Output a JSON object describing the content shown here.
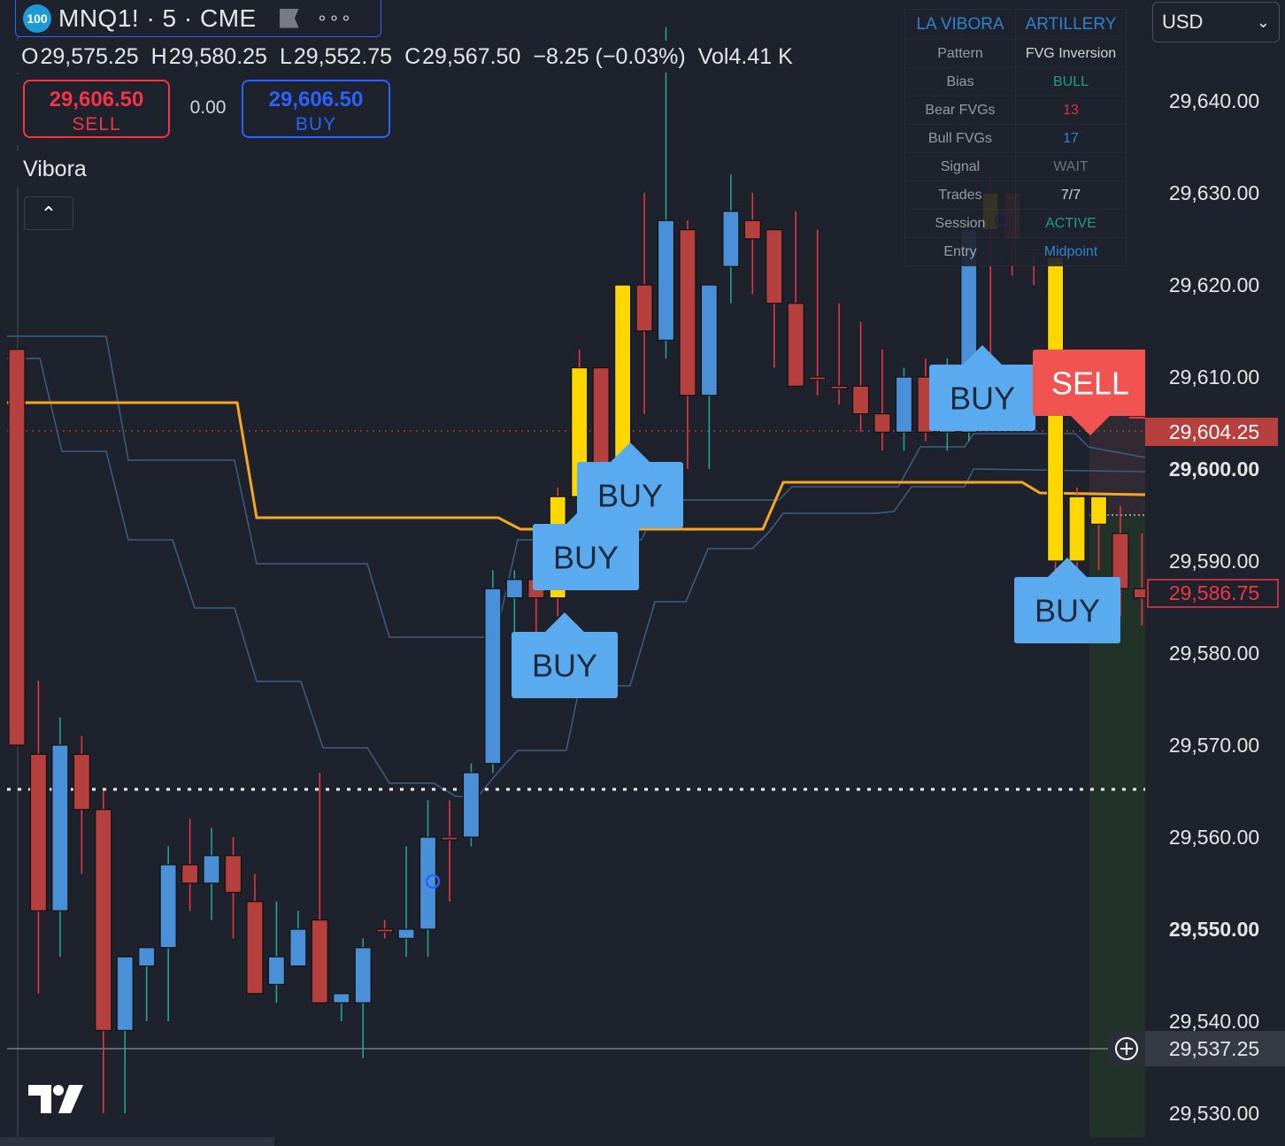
{
  "symbol": {
    "badge": "100",
    "text": "MNQ1! · 5 · CME"
  },
  "ohlc": {
    "open_label": "O",
    "open": "29,575.25",
    "high_label": "H",
    "high": "29,580.25",
    "low_label": "L",
    "low": "29,552.75",
    "close_label": "C",
    "close": "29,567.50",
    "change": "−8.25 (−0.03%)",
    "volume_label": "Vol",
    "volume": "4.41 K"
  },
  "order_panel": {
    "sell_price": "29,606.50",
    "sell_label": "SELL",
    "spread": "0.00",
    "buy_price": "29,606.50",
    "buy_label": "BUY"
  },
  "indicator": {
    "name": "Vibora",
    "collapse_icon": "chevron-up-icon"
  },
  "currency": {
    "value": "USD",
    "icon": "chevron-down-icon"
  },
  "info_table": {
    "header": [
      "LA VIBORA",
      "ARTILLERY"
    ],
    "rows": [
      {
        "label": "Pattern",
        "value": "FVG Inversion",
        "color": "#e6e6e6"
      },
      {
        "label": "Bias",
        "value": "BULL",
        "color": "#22ab94"
      },
      {
        "label": "Bear FVGs",
        "value": "13",
        "color": "#f23645"
      },
      {
        "label": "Bull FVGs",
        "value": "17",
        "color": "#2f8fe0"
      },
      {
        "label": "Signal",
        "value": "WAIT",
        "color": "#787b86"
      },
      {
        "label": "Trades",
        "value": "7/7",
        "color": "#e6e6e6"
      },
      {
        "label": "Session",
        "value": "ACTIVE",
        "color": "#22ab94"
      },
      {
        "label": "Entry",
        "value": "Midpoint",
        "color": "#2f8fe0"
      }
    ]
  },
  "price_axis": {
    "ticks": [
      "29,640.00",
      "29,630.00",
      "29,620.00",
      "29,610.00",
      "29,600.00",
      "29,590.00",
      "29,580.00",
      "29,570.00",
      "29,560.00",
      "29,550.00",
      "29,540.00",
      "29,530.00"
    ],
    "bold_ticks": [
      "29,600.00",
      "29,550.00"
    ],
    "labels": {
      "sell_price": "29,604.25",
      "last_price": "29,586.75",
      "crosshair_price": "29,537.25"
    }
  },
  "colors": {
    "bull": "#4a90d9",
    "bear": "#b6403d",
    "highlight": "#ffd700",
    "orange_line": "#f5a623",
    "band_line": "#3b5f85",
    "buy_label_bg": "#5aaaf0",
    "sell_label_bg": "#f05350"
  },
  "chart_data": {
    "type": "candlestick",
    "ylim": [
      29526,
      29650
    ],
    "candles": [
      {
        "o": 29613.0,
        "h": 29613.0,
        "l": 29570.0,
        "c": 29570.0,
        "t": "bear"
      },
      {
        "o": 29569.0,
        "h": 29577.0,
        "l": 29543.0,
        "c": 29552.0,
        "t": "bear"
      },
      {
        "o": 29552.0,
        "h": 29573.0,
        "l": 29547.0,
        "c": 29570.0,
        "t": "bull"
      },
      {
        "o": 29569.0,
        "h": 29571.0,
        "l": 29556.0,
        "c": 29563.0,
        "t": "bear"
      },
      {
        "o": 29563.0,
        "h": 29565.0,
        "l": 29530.0,
        "c": 29539.0,
        "t": "bear"
      },
      {
        "o": 29539.0,
        "h": 29547.0,
        "l": 29530.0,
        "c": 29547.0,
        "t": "bull"
      },
      {
        "o": 29546.0,
        "h": 29548.0,
        "l": 29540.0,
        "c": 29548.0,
        "t": "bull"
      },
      {
        "o": 29548.0,
        "h": 29559.0,
        "l": 29540.0,
        "c": 29557.0,
        "t": "bull"
      },
      {
        "o": 29557.0,
        "h": 29562.0,
        "l": 29552.0,
        "c": 29555.0,
        "t": "bear"
      },
      {
        "o": 29555.0,
        "h": 29561.0,
        "l": 29551.0,
        "c": 29558.0,
        "t": "bull"
      },
      {
        "o": 29558.0,
        "h": 29560.0,
        "l": 29549.0,
        "c": 29554.0,
        "t": "bear"
      },
      {
        "o": 29553.0,
        "h": 29556.0,
        "l": 29543.0,
        "c": 29543.0,
        "t": "bear"
      },
      {
        "o": 29544.0,
        "h": 29553.0,
        "l": 29542.0,
        "c": 29547.0,
        "t": "bull"
      },
      {
        "o": 29546.0,
        "h": 29552.0,
        "l": 29546.0,
        "c": 29550.0,
        "t": "bull"
      },
      {
        "o": 29551.0,
        "h": 29567.0,
        "l": 29544.0,
        "c": 29542.0,
        "t": "bear"
      },
      {
        "o": 29542.0,
        "h": 29543.0,
        "l": 29540.0,
        "c": 29543.0,
        "t": "bull"
      },
      {
        "o": 29542.0,
        "h": 29549.0,
        "l": 29536.0,
        "c": 29548.0,
        "t": "bull"
      },
      {
        "o": 29550.0,
        "h": 29551.0,
        "l": 29549.0,
        "c": 29550.0,
        "t": "bear"
      },
      {
        "o": 29549.0,
        "h": 29559.0,
        "l": 29547.0,
        "c": 29550.0,
        "t": "bull"
      },
      {
        "o": 29550.0,
        "h": 29564.0,
        "l": 29547.0,
        "c": 29560.0,
        "t": "bull"
      },
      {
        "o": 29560.0,
        "h": 29564.0,
        "l": 29553.0,
        "c": 29560.0,
        "t": "bear"
      },
      {
        "o": 29560.0,
        "h": 29568.0,
        "l": 29559.0,
        "c": 29567.0,
        "t": "bull"
      },
      {
        "o": 29568.0,
        "h": 29589.0,
        "l": 29567.0,
        "c": 29587.0,
        "t": "bull"
      },
      {
        "o": 29586.0,
        "h": 29589.0,
        "l": 29582.0,
        "c": 29588.0,
        "t": "bull"
      },
      {
        "o": 29588.0,
        "h": 29589.0,
        "l": 29576.0,
        "c": 29586.0,
        "t": "bear"
      },
      {
        "o": 29586.0,
        "h": 29598.0,
        "l": 29584.0,
        "c": 29597.0,
        "t": "hl"
      },
      {
        "o": 29597.0,
        "h": 29613.0,
        "l": 29597.0,
        "c": 29611.0,
        "t": "hl"
      },
      {
        "o": 29600.0,
        "h": 29611.0,
        "l": 29592.0,
        "c": 29611.0,
        "t": "bear"
      },
      {
        "o": 29600.0,
        "h": 29620.0,
        "l": 29598.0,
        "c": 29620.0,
        "t": "hl"
      },
      {
        "o": 29620.0,
        "h": 29630.0,
        "l": 29606.0,
        "c": 29615.0,
        "t": "bear"
      },
      {
        "o": 29614.0,
        "h": 29648.0,
        "l": 29612.0,
        "c": 29627.0,
        "t": "bull"
      },
      {
        "o": 29626.0,
        "h": 29627.0,
        "l": 29600.0,
        "c": 29608.0,
        "t": "bear"
      },
      {
        "o": 29608.0,
        "h": 29620.0,
        "l": 29600.0,
        "c": 29620.0,
        "t": "bull"
      },
      {
        "o": 29622.0,
        "h": 29632.0,
        "l": 29618.0,
        "c": 29628.0,
        "t": "bull"
      },
      {
        "o": 29627.0,
        "h": 29630.0,
        "l": 29619.0,
        "c": 29625.0,
        "t": "bear"
      },
      {
        "o": 29626.0,
        "h": 29626.0,
        "l": 29611.0,
        "c": 29618.0,
        "t": "bear"
      },
      {
        "o": 29618.0,
        "h": 29628.0,
        "l": 29609.0,
        "c": 29609.0,
        "t": "bear"
      },
      {
        "o": 29610.0,
        "h": 29626.0,
        "l": 29608.0,
        "c": 29610.0,
        "t": "bear"
      },
      {
        "o": 29609.0,
        "h": 29618.0,
        "l": 29607.0,
        "c": 29609.0,
        "t": "bear"
      },
      {
        "o": 29609.0,
        "h": 29616.0,
        "l": 29604.0,
        "c": 29606.0,
        "t": "bear"
      },
      {
        "o": 29606.0,
        "h": 29613.0,
        "l": 29602.0,
        "c": 29604.0,
        "t": "bear"
      },
      {
        "o": 29604.0,
        "h": 29611.0,
        "l": 29602.0,
        "c": 29610.0,
        "t": "bull"
      },
      {
        "o": 29610.0,
        "h": 29612.0,
        "l": 29603.0,
        "c": 29604.0,
        "t": "bear"
      },
      {
        "o": 29604.0,
        "h": 29612.0,
        "l": 29602.0,
        "c": 29610.0,
        "t": "bull"
      },
      {
        "o": 29604.0,
        "h": 29627.0,
        "l": 29603.0,
        "c": 29626.0,
        "t": "bull"
      },
      {
        "o": 29626.0,
        "h": 29632.0,
        "l": 29612.0,
        "c": 29630.0,
        "t": "hl"
      },
      {
        "o": 29630.0,
        "h": 29628.0,
        "l": 29621.0,
        "c": 29625.0,
        "t": "bear"
      },
      {
        "o": 29624.0,
        "h": 29624.0,
        "l": 29620.0,
        "c": 29624.0,
        "t": "bear"
      },
      {
        "o": 29623.0,
        "h": 29623.0,
        "l": 29587.0,
        "c": 29590.0,
        "t": "hl"
      },
      {
        "o": 29590.0,
        "h": 29598.0,
        "l": 29585.0,
        "c": 29597.0,
        "t": "hl"
      },
      {
        "o": 29594.0,
        "h": 29597.0,
        "l": 29589.0,
        "c": 29597.0,
        "t": "hl"
      },
      {
        "o": 29593.0,
        "h": 29596.0,
        "l": 29584.0,
        "c": 29587.0,
        "t": "bear"
      },
      {
        "o": 29587.0,
        "h": 29593.0,
        "l": 29583.0,
        "c": 29586.0,
        "t": "bear"
      }
    ],
    "signals": [
      {
        "text": "BUY",
        "candle": 21
      },
      {
        "text": "BUY",
        "candle": 24
      },
      {
        "text": "BUY",
        "candle": 27
      },
      {
        "text": "BUY",
        "candle": 43
      },
      {
        "text": "SELL",
        "candle": 48
      },
      {
        "text": "BUY",
        "candle": 50
      }
    ]
  }
}
